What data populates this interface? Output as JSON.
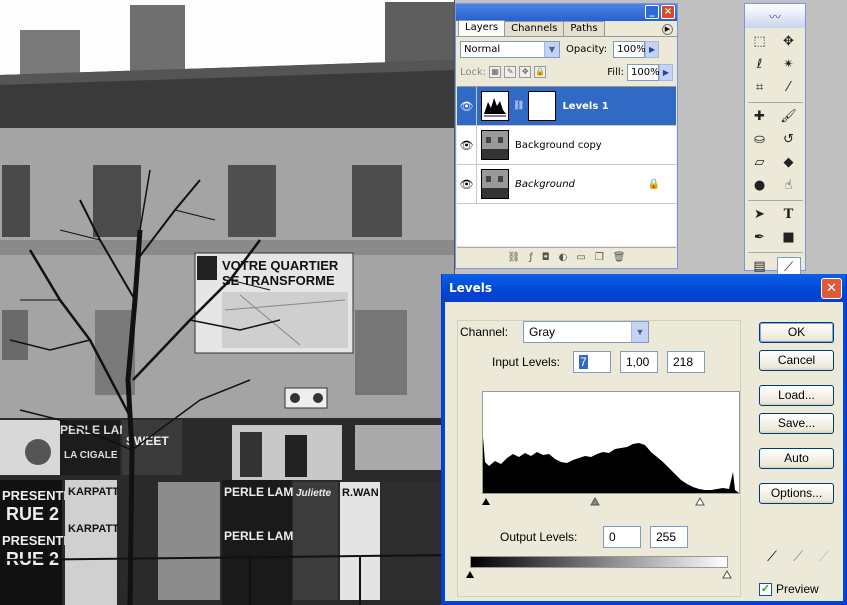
{
  "photo": {
    "poster_title": [
      "VOTRE QUARTIER",
      "SE TRANSFORME"
    ],
    "posters": [
      "PERLE LAMA",
      "LA CIGALE",
      "KARPATT",
      "PRESENTE",
      "RUE 2",
      "R.WAN",
      "PERLE LAMA",
      "SWEET",
      "Juliette"
    ]
  },
  "layers_panel": {
    "tabs": [
      "Layers",
      "Channels",
      "Paths"
    ],
    "blend_mode": "Normal",
    "opacity_label": "Opacity:",
    "opacity_value": "100%",
    "lock_label": "Lock:",
    "fill_label": "Fill:",
    "fill_value": "100%",
    "layers": [
      {
        "name": "Levels 1",
        "selected": true
      },
      {
        "name": "Background copy",
        "selected": false
      },
      {
        "name": "Background",
        "selected": false,
        "italic": true,
        "locked": true
      }
    ]
  },
  "tools_panel": {
    "tools": [
      "marquee-tool",
      "move-tool",
      "lasso-tool",
      "magic-wand-tool",
      "crop-tool",
      "slice-tool",
      "healing-brush-tool",
      "brush-tool",
      "clone-stamp-tool",
      "history-brush-tool",
      "eraser-tool",
      "paint-bucket-tool",
      "dodge-tool",
      "smudge-tool",
      "path-selection-tool",
      "type-tool",
      "pen-tool",
      "rectangle-tool",
      "notes-tool",
      "eyedropper-tool"
    ]
  },
  "levels_dialog": {
    "title": "Levels",
    "channel_label": "Channel:",
    "channel_value": "Gray",
    "input_levels_label": "Input Levels:",
    "input_black": "7",
    "input_gamma": "1,00",
    "input_white": "218",
    "output_levels_label": "Output Levels:",
    "output_black": "0",
    "output_white": "255",
    "buttons": {
      "ok": "OK",
      "cancel": "Cancel",
      "load": "Load...",
      "save": "Save...",
      "auto": "Auto",
      "options": "Options..."
    },
    "preview_label": "Preview",
    "preview_checked": true
  }
}
